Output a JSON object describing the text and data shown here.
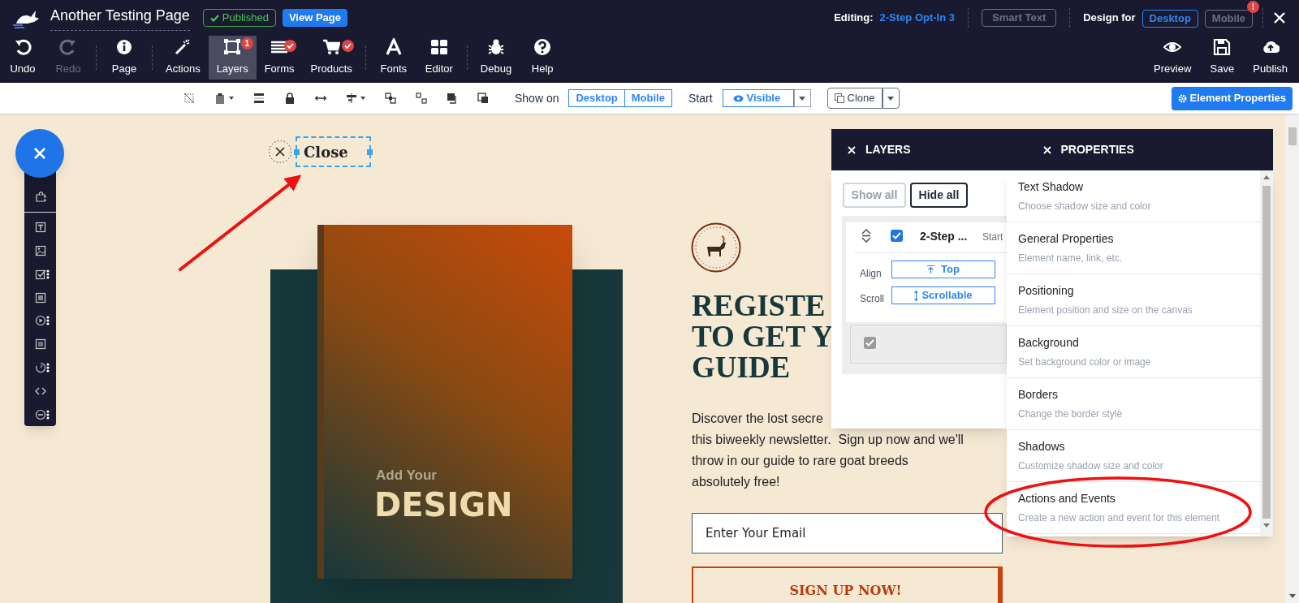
{
  "header": {
    "page_title": "Another Testing Page",
    "status": "Published",
    "view_button": "View Page",
    "editing_label": "Editing:",
    "editing_value": "2-Step Opt-In 3",
    "smart_text": "Smart Text",
    "design_for_label": "Design for",
    "design_for": [
      {
        "label": "Desktop",
        "selected": true
      },
      {
        "label": "Mobile",
        "selected": false,
        "alert": "!"
      }
    ]
  },
  "toolbar": {
    "groups": [
      [
        {
          "kind": "undo",
          "label": "Undo",
          "disabled": false,
          "selected": false
        },
        {
          "kind": "redo",
          "label": "Redo",
          "disabled": true,
          "selected": false
        }
      ],
      [
        {
          "kind": "info",
          "label": "Page",
          "disabled": false,
          "selected": false
        }
      ],
      [
        {
          "kind": "wand",
          "label": "Actions",
          "disabled": false,
          "selected": false
        },
        {
          "kind": "layers",
          "label": "Layers",
          "disabled": false,
          "selected": true,
          "badge": {
            "kind": "count",
            "text": "1"
          }
        },
        {
          "kind": "list",
          "label": "Forms",
          "disabled": false,
          "selected": false,
          "badge": {
            "kind": "check"
          }
        },
        {
          "kind": "cart",
          "label": "Products",
          "disabled": false,
          "selected": false,
          "badge": {
            "kind": "check"
          }
        }
      ],
      [
        {
          "kind": "font",
          "label": "Fonts",
          "disabled": false,
          "selected": false
        },
        {
          "kind": "grid",
          "label": "Editor",
          "disabled": false,
          "selected": false
        }
      ],
      [
        {
          "kind": "bug",
          "label": "Debug",
          "disabled": false,
          "selected": false
        },
        {
          "kind": "help",
          "label": "Help",
          "disabled": false,
          "selected": false
        }
      ]
    ],
    "right": [
      {
        "kind": "eye",
        "label": "Preview"
      },
      {
        "kind": "save",
        "label": "Save"
      },
      {
        "kind": "upload",
        "label": "Publish"
      }
    ]
  },
  "subtoolbar": {
    "tools": [
      {
        "kind": "no-crop",
        "caret": false
      },
      {
        "kind": "clipboard",
        "caret": true
      },
      {
        "kind": "bars",
        "caret": false
      },
      {
        "kind": "lock",
        "caret": false
      },
      {
        "kind": "stretch",
        "caret": false
      },
      {
        "kind": "align",
        "caret": true
      },
      {
        "kind": "group",
        "caret": false
      },
      {
        "kind": "ungroup",
        "caret": false
      },
      {
        "kind": "front",
        "caret": false
      },
      {
        "kind": "back",
        "caret": false
      }
    ],
    "show_on_label": "Show on",
    "show_on": [
      "Desktop",
      "Mobile"
    ],
    "start_label": "Start",
    "start_value": "Visible",
    "clone": "Clone",
    "element_properties": "Element Properties"
  },
  "element_tools": [
    {
      "kind": "puzzle",
      "more": false
    },
    {
      "kind": "text",
      "more": false
    },
    {
      "kind": "image",
      "more": false
    },
    {
      "kind": "checkbox",
      "more": true
    },
    {
      "kind": "box",
      "more": false
    },
    {
      "kind": "video",
      "more": true
    },
    {
      "kind": "form",
      "more": false
    },
    {
      "kind": "timer",
      "more": true
    },
    {
      "kind": "code",
      "more": false
    },
    {
      "kind": "minus",
      "more": true
    }
  ],
  "canvas": {
    "close_label": "Close",
    "close_selected": true,
    "cover_kicker": "Add Your",
    "cover_title": "DESIGN",
    "headline": [
      "REGISTE",
      "TO GET Y",
      "GUIDE"
    ],
    "paragraph": [
      "Discover the lost secre",
      "this biweekly newsletter.  Sign up now and we'll",
      "throw in our guide to rare goat breeds",
      "absolutely free!"
    ],
    "email": {
      "placeholder": "Enter Your Email"
    },
    "signup_button": "SIGN UP NOW!"
  },
  "layers": {
    "title": "LAYERS",
    "show_all": {
      "label": "Show all",
      "disabled": true
    },
    "hide_all": {
      "label": "Hide all",
      "disabled": false
    },
    "layer": {
      "name": "2-Step ...",
      "checked": true,
      "start": "Start",
      "align_label": "Align",
      "align": "Top",
      "scroll_label": "Scroll",
      "scroll": "Scrollable"
    },
    "sublayer": {
      "checked": true
    }
  },
  "properties": {
    "title": "PROPERTIES",
    "items": [
      {
        "title": "Text Shadow",
        "desc": "Choose shadow size and color"
      },
      {
        "title": "General Properties",
        "desc": "Element name, link, etc."
      },
      {
        "title": "Positioning",
        "desc": "Element position and size on the canvas"
      },
      {
        "title": "Background",
        "desc": "Set background color or image"
      },
      {
        "title": "Borders",
        "desc": "Change the border style"
      },
      {
        "title": "Shadows",
        "desc": "Customize shadow size and color"
      },
      {
        "title": "Actions and Events",
        "desc": "Create a new action and event for this element"
      }
    ]
  }
}
